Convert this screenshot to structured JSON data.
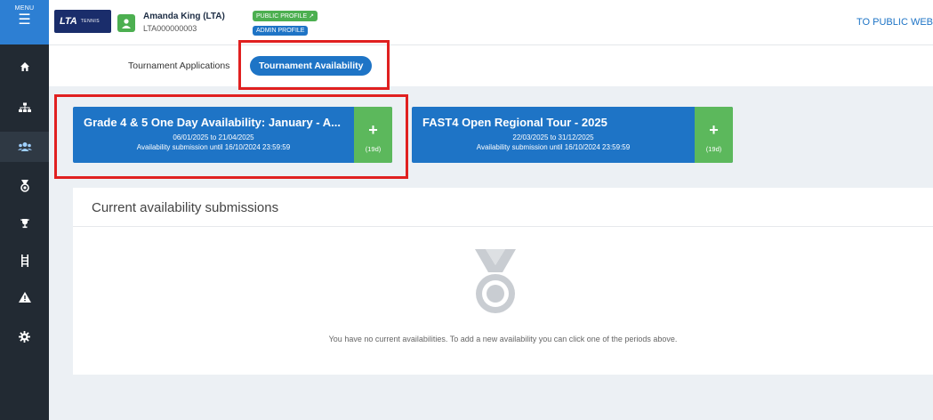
{
  "sidebar": {
    "menu_label": "MENU",
    "items": [
      {
        "name": "home-icon"
      },
      {
        "name": "org-chart-icon"
      },
      {
        "name": "users-icon",
        "active": true
      },
      {
        "name": "medal-icon"
      },
      {
        "name": "trophy-icon"
      },
      {
        "name": "ladder-icon"
      },
      {
        "name": "warning-icon"
      },
      {
        "name": "gear-icon"
      }
    ]
  },
  "header": {
    "logo_text": "LTA",
    "logo_sub": "TENNIS",
    "user_name": "Amanda King (LTA)",
    "user_id": "LTA000000003",
    "public_profile_label": "PUBLIC PROFILE",
    "admin_profile_label": "ADMIN PROFILE",
    "public_web_link": "TO PUBLIC WEB"
  },
  "tabs": {
    "applications": "Tournament Applications",
    "availability": "Tournament Availability"
  },
  "periods": [
    {
      "title": "Grade 4 & 5 One Day Availability: January - A...",
      "dates": "06/01/2025 to 21/04/2025",
      "until": "Availability submission until 16/10/2024 23:59:59",
      "days_left": "(19d)"
    },
    {
      "title": "FAST4 Open Regional Tour - 2025",
      "dates": "22/03/2025 to 31/12/2025",
      "until": "Availability submission until 16/10/2024 23:59:59",
      "days_left": "(19d)"
    }
  ],
  "submissions": {
    "title": "Current availability submissions",
    "empty_message": "You have no current availabilities. To add a new availability you can click one of the periods above."
  },
  "colors": {
    "primary": "#1e74c6",
    "success": "#5cb85c",
    "highlight": "#e02020",
    "sidebar": "#222a33"
  }
}
